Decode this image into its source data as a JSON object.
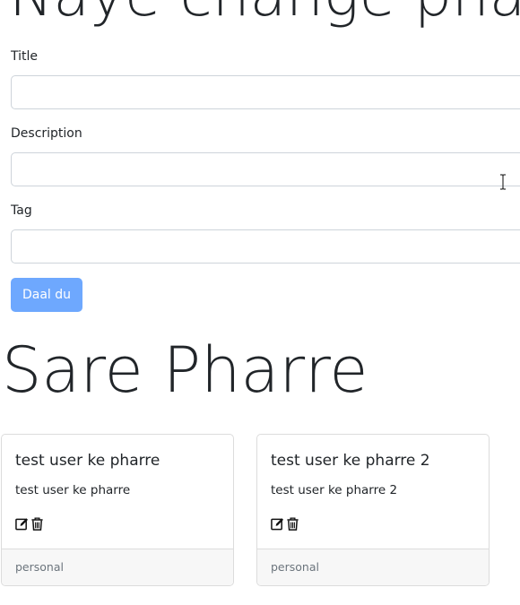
{
  "form": {
    "heading": "Naye change pharre",
    "title_label": "Title",
    "title_value": "",
    "description_label": "Description",
    "description_value": "",
    "tag_label": "Tag",
    "tag_value": "",
    "submit_label": "Daal du"
  },
  "notes_section": {
    "heading": "Sare Pharre",
    "cards": [
      {
        "title": "test user ke pharre",
        "description": "test user ke pharre",
        "tag": "personal",
        "edit_icon": "edit-icon",
        "delete_icon": "trash-icon"
      },
      {
        "title": "test user ke pharre 2",
        "description": "test user ke pharre 2",
        "tag": "personal",
        "edit_icon": "edit-icon",
        "delete_icon": "trash-icon"
      }
    ]
  },
  "colors": {
    "button_bg": "#6ea8fe",
    "input_border": "#ced4da",
    "card_footer_bg": "#f7f7f7",
    "muted_text": "#6c757d"
  }
}
